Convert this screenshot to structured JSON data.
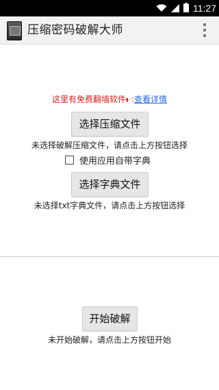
{
  "status_bar": {
    "time": "11:27",
    "icons": [
      "wifi-icon",
      "signal-icon",
      "battery-icon"
    ]
  },
  "action_bar": {
    "title": "压缩密码破解大师",
    "menu_icon": "overflow-menu-icon"
  },
  "promo": {
    "text": "这里有免费翻墙软件",
    "separator": ":",
    "link": "查看详情",
    "colors": {
      "promo_text": "#e01c1c",
      "link": "#2a6bd8"
    }
  },
  "archive": {
    "button": "选择压缩文件",
    "hint": "未选择破解压缩文件，请点击上方按钮选择"
  },
  "dictionary_option": {
    "label": "使用应用自带字典",
    "checked": false
  },
  "dictionary": {
    "button": "选择字典文件",
    "hint": "未选择txt字典文件，请点击上方按钮选择"
  },
  "crack": {
    "button": "开始破解",
    "hint": "未开始破解，请点击上方按钮开始"
  }
}
